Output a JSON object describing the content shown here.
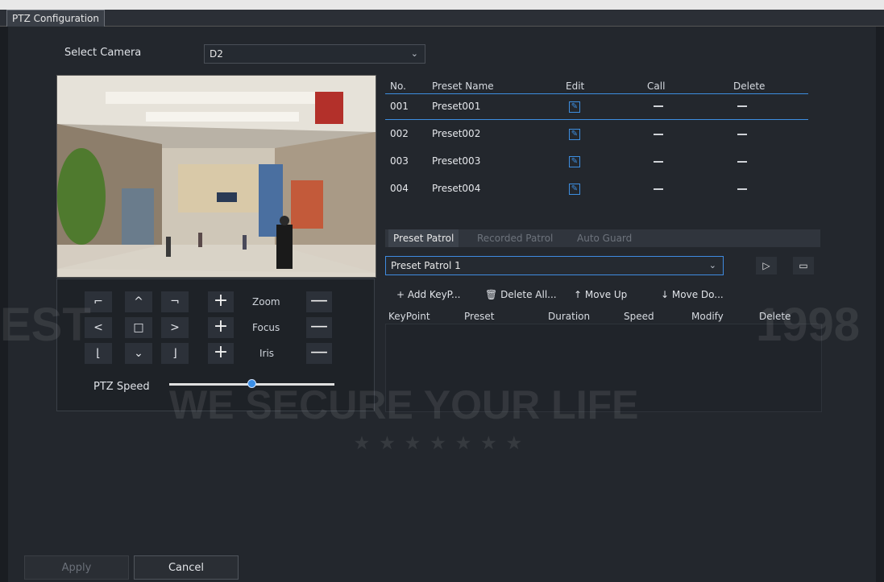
{
  "window": {
    "tab_title": "PTZ Configuration"
  },
  "camera": {
    "label": "Select Camera",
    "value": "D2"
  },
  "ptz": {
    "pad": {
      "up_left": "⌐",
      "up": "^",
      "up_right": "¬",
      "left": "<",
      "center": "□",
      "right": ">",
      "down_left": "⌊",
      "down": "⌄",
      "down_right": "⌋"
    },
    "zoom": {
      "label": "Zoom",
      "plus": "+",
      "minus": "—"
    },
    "focus": {
      "label": "Focus",
      "plus": "+",
      "minus": "—"
    },
    "iris": {
      "label": "Iris",
      "plus": "+",
      "minus": "—"
    },
    "speed": {
      "label": "PTZ Speed",
      "level_fraction": 0.5
    }
  },
  "presets": {
    "headers": {
      "no": "No.",
      "name": "Preset Name",
      "edit": "Edit",
      "call": "Call",
      "delete": "Delete"
    },
    "rows": [
      {
        "no": "001",
        "name": "Preset001"
      },
      {
        "no": "002",
        "name": "Preset002"
      },
      {
        "no": "003",
        "name": "Preset003"
      },
      {
        "no": "004",
        "name": "Preset004"
      }
    ]
  },
  "patrol": {
    "tabs": [
      "Preset Patrol",
      "Recorded Patrol",
      "Auto Guard"
    ],
    "selected": "Preset Patrol 1",
    "toolbar": {
      "add": "+ Add KeyP...",
      "delete_all": "Delete All...",
      "move_up": "Move Up",
      "move_down": "Move Do..."
    },
    "columns": [
      "KeyPoint",
      "Preset",
      "Duration",
      "Speed",
      "Modify",
      "Delete"
    ]
  },
  "footer": {
    "apply": "Apply",
    "cancel": "Cancel"
  },
  "watermark": {
    "slogan": "WE SECURE YOUR LIFE",
    "left_fragment": "EST",
    "right_fragment": "1998",
    "stars": "★ ★ ★ ★ ★ ★ ★"
  },
  "colors": {
    "accent": "#3d8ee0",
    "background": "#23272d"
  }
}
